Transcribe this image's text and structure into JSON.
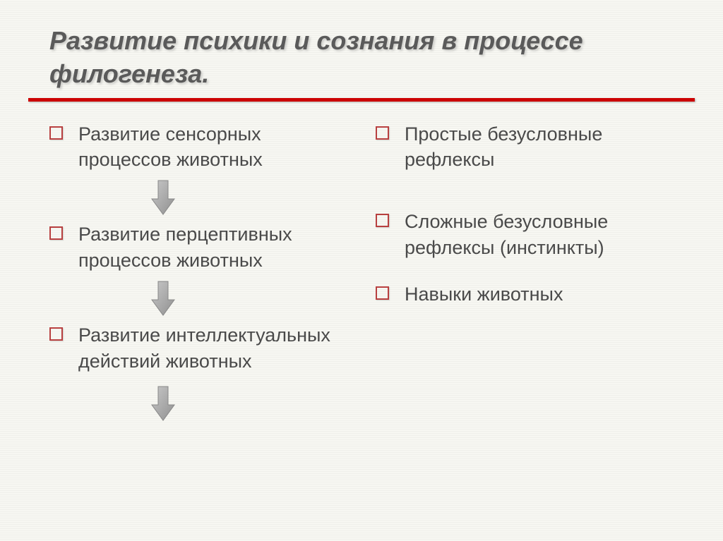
{
  "title": "Развитие психики и сознания в процессе филогенеза.",
  "leftColumn": {
    "item1": "Развитие сенсорных процессов животных",
    "item2": "Развитие перцептивных процессов животных",
    "item3": "Развитие интеллектуальных действий животных"
  },
  "rightColumn": {
    "item1": "Простые безусловные рефлексы",
    "item2": "Сложные безусловные рефлексы (инстинкты)",
    "item3": "Навыки животных"
  }
}
